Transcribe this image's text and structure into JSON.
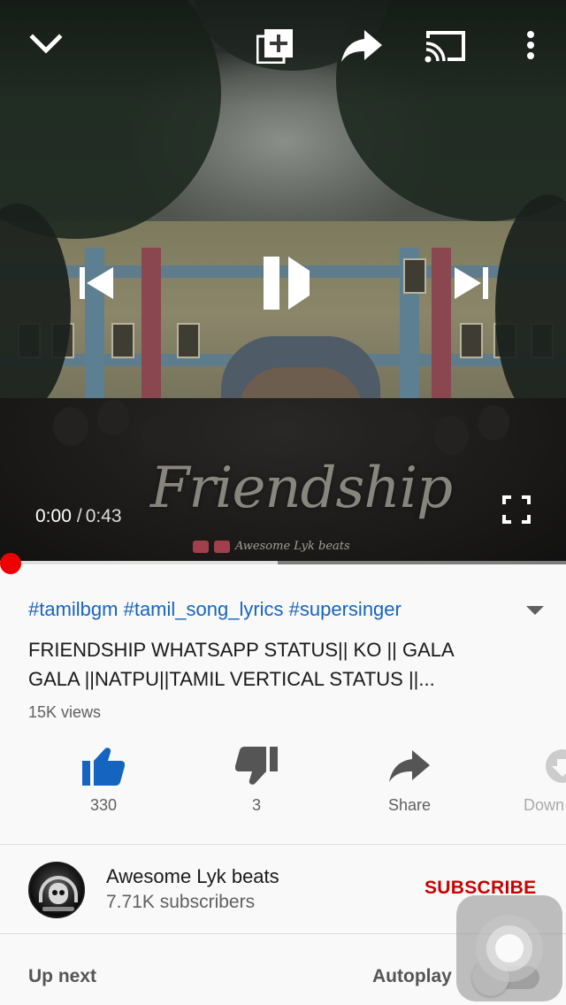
{
  "player": {
    "watermark_text": "Friendship",
    "watermark_credit": "Awesome Lyk beats",
    "current_time": "0:00",
    "separator": "/",
    "duration": "0:43",
    "progress_fraction": 0.0,
    "buffered_fraction": 0.49,
    "icons": {
      "collapse": "chevron-down-icon",
      "add_to_playlist": "add-to-playlist-icon",
      "share": "share-icon",
      "cast": "cast-icon",
      "more": "more-vert-icon",
      "previous": "skip-previous-icon",
      "play_pause": "pause-icon",
      "next": "skip-next-icon",
      "fullscreen": "fullscreen-icon"
    }
  },
  "video": {
    "hashtags": "#tamilbgm #tamil_song_lyrics #supersinger",
    "title": "FRIENDSHIP WHATSAPP STATUS|| KO || GALA GALA ||NATPU||TAMIL VERTICAL STATUS ||...",
    "views": "15K views"
  },
  "actions": {
    "like_count": "330",
    "dislike_count": "3",
    "share_label": "Share",
    "download_label": "Down"
  },
  "channel": {
    "name": "Awesome Lyk beats",
    "subscribers": "7.71K subscribers",
    "subscribe_label": "SUBSCRIBE"
  },
  "up_next": {
    "label": "Up next",
    "autoplay_label": "Autoplay",
    "autoplay_on": false
  },
  "colors": {
    "link_blue": "#1565c0",
    "like_blue": "#1565c0",
    "subscribe_red": "#cc0000",
    "progress_red": "#ee0000"
  }
}
